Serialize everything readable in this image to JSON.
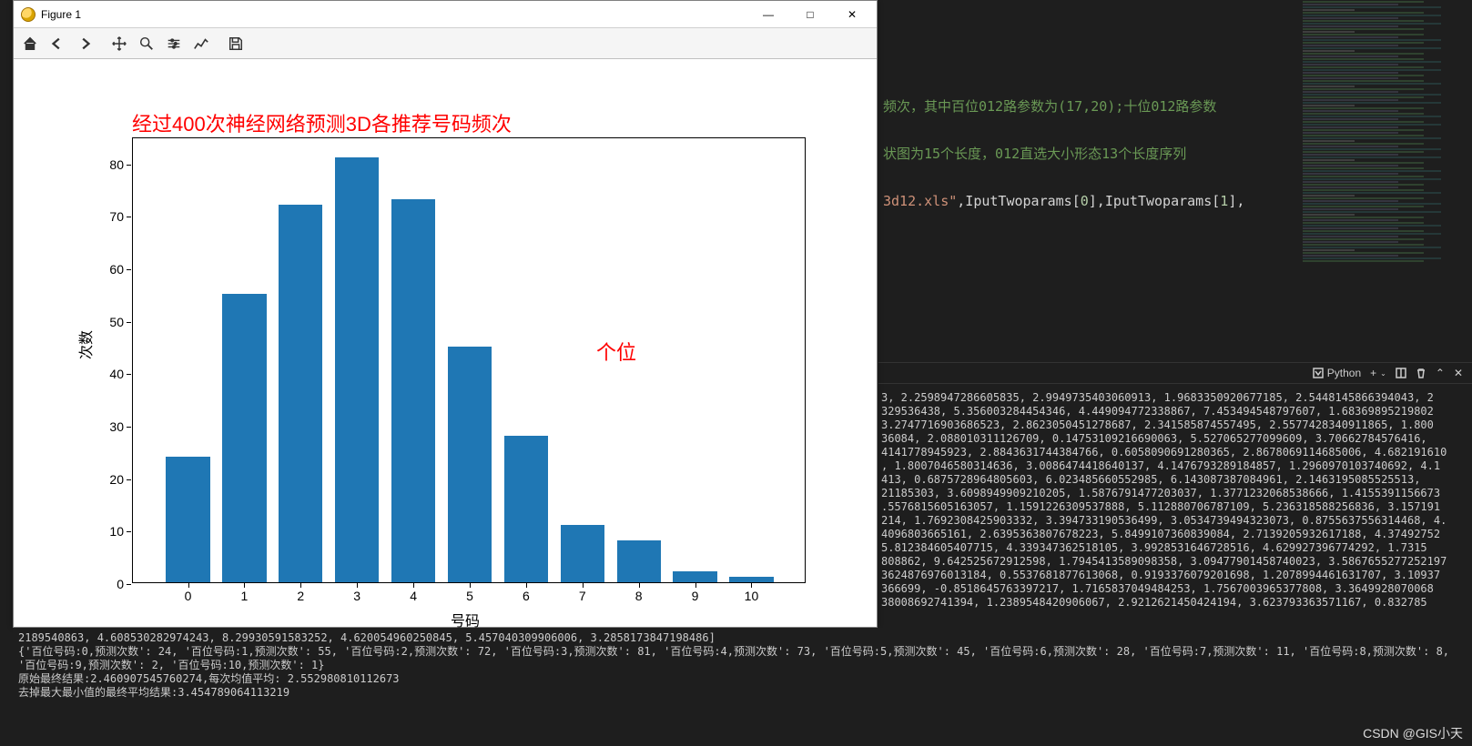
{
  "window": {
    "title": "Figure 1",
    "btn_min": "—",
    "btn_max": "□",
    "btn_close": "✕"
  },
  "chart_data": {
    "type": "bar",
    "title": "经过400次神经网络预测3D各推荐号码频次",
    "annotation": "个位",
    "xlabel": "号码",
    "ylabel": "次数",
    "categories": [
      "0",
      "1",
      "2",
      "3",
      "4",
      "5",
      "6",
      "7",
      "8",
      "9",
      "10"
    ],
    "values": [
      24,
      55,
      72,
      81,
      73,
      45,
      28,
      11,
      8,
      2,
      1
    ],
    "yticks": [
      0,
      10,
      20,
      30,
      40,
      50,
      60,
      70,
      80
    ],
    "ylim": [
      0,
      85
    ],
    "bar_color": "#1f77b4"
  },
  "editor": {
    "line1": "频次，其中百位012路参数为(17,20);十位012路参数",
    "line2": "状图为15个长度，012直选大小形态13个长度序列",
    "line3a": "3d12.xls\"",
    "line3b": ",IputTwoparams[",
    "line3c": "0",
    "line3d": "],IputTwoparams[",
    "line3e": "1",
    "line3f": "],"
  },
  "terminal_header": {
    "lang": "Python",
    "plus": "+",
    "split": "split",
    "trash": "trash",
    "up": "⌃",
    "close": "✕"
  },
  "terminal_top": "3, 2.2598947286605835, 2.9949735403060913, 1.9683350920677185, 2.5448145866394043, 2\n329536438, 5.356003284454346, 4.449094772338867, 7.453494548797607, 1.68369895219802\n3.2747716903686523, 2.8623050451278687, 2.341585874557495, 2.5577428340911865, 1.800\n36084, 2.088010311126709, 0.14753109216690063, 5.527065277099609, 3.70662784576416,\n4141778945923, 2.8843631744384766, 0.6058090691280365, 2.8678069114685006, 4.682191610\n, 1.8007046580314636, 3.0086474418640137, 4.1476793289184857, 1.2960970103740692, 4.1\n413, 0.6875728964805603, 6.023485660552985, 6.143087387084961, 2.1463195085525513,\n21185303, 3.6098949909210205, 1.5876791477203037, 1.3771232068538666, 1.4155391156673\n.5576815605163057, 1.1591226309537888, 5.112880706787109, 5.236318588256836, 3.157191\n214, 1.7692308425903332, 3.394733190536499, 3.0534739494323073, 0.8755637556314468, 4.\n4096803665161, 2.6395363807678223, 5.8499107360839084, 2.7139205932617188, 4.37492752\n5.812384605407715, 4.339347362518105, 3.9928531646728516, 4.629927396774292, 1.7315\n808862, 9.642525672912598, 1.7945413589098358, 3.09477901458740023, 3.5867655277252197\n3624876976013184, 0.5537681877613068, 0.9193376079201698, 1.2078994461631707, 3.10937\n366699, -0.8518645763397217, 1.7165837049484253, 1.7567003965377808, 3.3649928070068\n38008692741394, 1.2389548420906067, 2.9212621450424194, 3.623793363571167, 0.832785",
  "terminal_bottom": {
    "l0": "2189540863, 4.608530282974243, 8.29930591583252, 4.620054960250845, 5.457040309906006, 3.2858173847198486]",
    "l1": "{'百位号码:0,预测次数': 24, '百位号码:1,预测次数': 55, '百位号码:2,预测次数': 72, '百位号码:3,预测次数': 81, '百位号码:4,预测次数': 73, '百位号码:5,预测次数': 45, '百位号码:6,预测次数': 28, '百位号码:7,预测次数': 11, '百位号码:8,预测次数': 8, '百位号码:9,预测次数': 2, '百位号码:10,预测次数': 1}",
    "l2": "原始最终结果:2.460907545760274,每次均值平均: 2.552980810112673",
    "l3": "去掉最大最小值的最终平均结果:3.454789064113219"
  },
  "watermark": "CSDN @GIS小天"
}
